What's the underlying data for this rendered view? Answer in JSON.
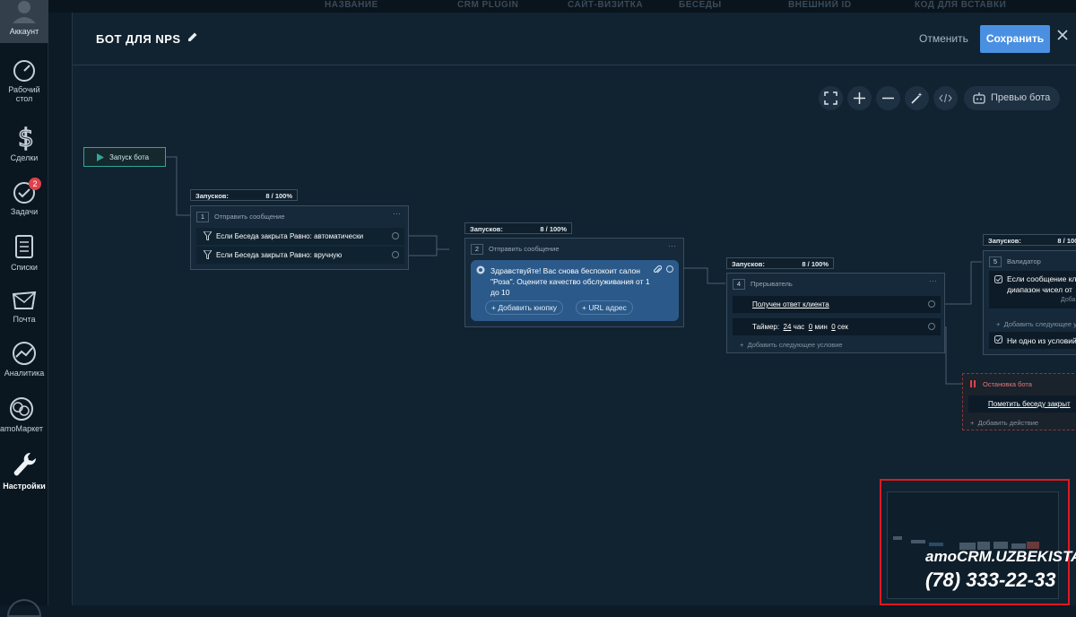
{
  "sidebar": {
    "account": "Аккаунт",
    "items": [
      {
        "label": "Рабочий стол",
        "icon": "dashboard-icon"
      },
      {
        "label": "Сделки",
        "icon": "dollar-icon"
      },
      {
        "label": "Задачи",
        "icon": "check-circle-icon",
        "badge": "2"
      },
      {
        "label": "Списки",
        "icon": "list-icon"
      },
      {
        "label": "Почта",
        "icon": "mail-icon"
      },
      {
        "label": "Аналитика",
        "icon": "analytics-icon"
      },
      {
        "label": "amoМаркет",
        "icon": "market-icon"
      },
      {
        "label": "Настройки",
        "icon": "wrench-icon"
      }
    ]
  },
  "background_columns": [
    "НАЗВАНИЕ",
    "CRM PLUGIN",
    "САЙТ-ВИЗИТКА",
    "БЕСЕДЫ",
    "ВНЕШНИЙ ID",
    "КОД ДЛЯ ВСТАВКИ"
  ],
  "header": {
    "title": "БОТ ДЛЯ NPS",
    "cancel": "Отменить",
    "save": "Сохранить"
  },
  "toolbar": {
    "preview": "Превью бота"
  },
  "flow": {
    "start": "Запуск бота",
    "runs_label": "Запусков:",
    "runs_value": "8 / 100%",
    "node1": {
      "num": "1",
      "title": "Отправить сообщение",
      "conditions": [
        "Если Беседа закрыта Равно: автоматически",
        "Если Беседа закрыта Равно: вручную"
      ]
    },
    "node2": {
      "num": "2",
      "title": "Отправить сообщение",
      "message": "Здравствуйте! Вас снова беспокоит салон \"Роза\". Оцените качество обслуживания от 1 до 10",
      "add_button": "+ Добавить кнопку",
      "url_button": "+ URL адрес"
    },
    "node4": {
      "num": "4",
      "title": "Прерыватель",
      "row1": "Получен ответ клиента",
      "timer_label": "Таймер:",
      "timer_hours": "24",
      "timer_h": "час",
      "timer_min": "0",
      "timer_m": "мин",
      "timer_sec": "0",
      "timer_s": "сек",
      "add_condition": "Добавить следующее условие"
    },
    "node5": {
      "num": "5",
      "title": "Валидатор",
      "row1_line1": "Если сообщение кл",
      "row1_line2": "диапазон чисел от",
      "row1_extra": "Доба",
      "add_condition": "Добавить следующее у",
      "row2": "Ни одно из условий"
    },
    "stop": {
      "title": "Остановка бота",
      "row": "Пометить беседу закрыт",
      "add_action": "Добавить действие"
    }
  },
  "watermark": {
    "brand": "amoCRM.UZBEKISTAN",
    "phone": "(78) 333-22-33"
  }
}
